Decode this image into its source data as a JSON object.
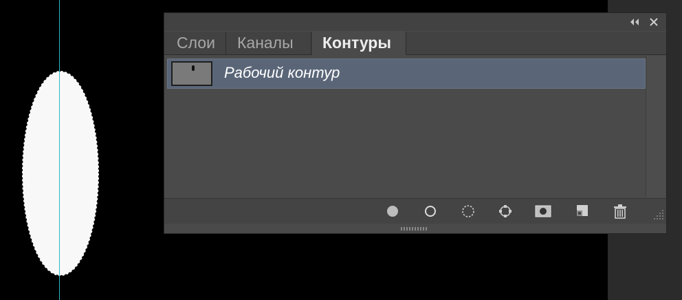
{
  "panel": {
    "tabs": [
      {
        "label": "Слои",
        "active": false
      },
      {
        "label": "Каналы",
        "active": false
      },
      {
        "label": "Контуры",
        "active": true
      }
    ],
    "paths": [
      {
        "name": "Рабочий контур",
        "selected": true
      }
    ],
    "bottom_tools": [
      "fill-path-icon",
      "stroke-path-icon",
      "load-selection-icon",
      "make-path-icon",
      "add-mask-icon",
      "new-path-icon",
      "delete-path-icon"
    ]
  },
  "colors": {
    "guide": "#2fb6c3",
    "panel_bg": "#4a4a4a",
    "selected_row": "#5a6678"
  }
}
